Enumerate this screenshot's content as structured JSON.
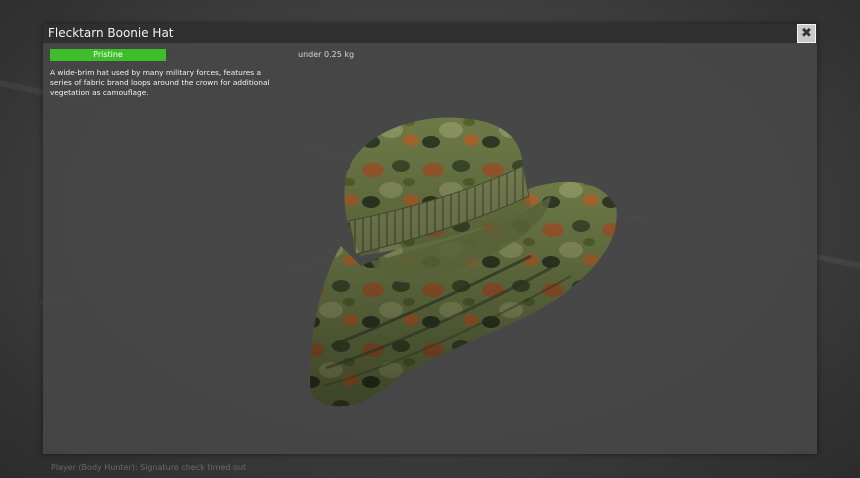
{
  "window": {
    "title": "Flecktarn Boonie Hat",
    "close_icon": "close-icon",
    "close_glyph": "✖"
  },
  "item": {
    "condition": "Pristine",
    "condition_color": "#3fbe2c",
    "weight": "under 0.25 kg",
    "description": "A wide-brim hat used by many military forces, features a series of fabric brand loops around the crown for additional vegetation as camouflage.",
    "preview_icon": "boonie-hat-model"
  },
  "status_message": "Player (Body Hunter): Signature check timed out"
}
